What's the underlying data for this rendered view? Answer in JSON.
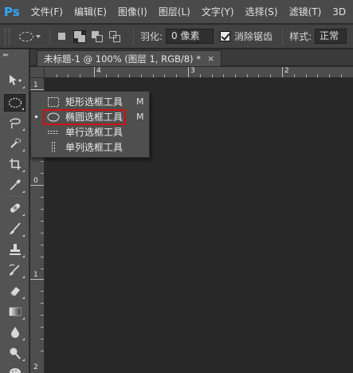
{
  "app": {
    "logo": "Ps"
  },
  "menubar": {
    "items": [
      "文件(F)",
      "编辑(E)",
      "图像(I)",
      "图层(L)",
      "文字(Y)",
      "选择(S)",
      "滤镜(T)",
      "3D"
    ]
  },
  "options": {
    "feather_label": "羽化:",
    "feather_value": "0 像素",
    "antialias_label": "消除锯齿",
    "antialias_checked": true,
    "style_label": "样式:",
    "style_value": "正常"
  },
  "document_tab": {
    "title": "未标题-1 @ 100% (图层 1, RGB/8) *",
    "close": "×"
  },
  "rulers": {
    "top_labels": [
      "4",
      "3",
      "2"
    ],
    "left_labels": [
      "1",
      "0",
      "1",
      "2"
    ]
  },
  "toolbox": {
    "collapse": "▸▸"
  },
  "flyout": {
    "items": [
      {
        "label": "矩形选框工具",
        "key": "M",
        "icon": "rect-marquee-icon",
        "selected": false
      },
      {
        "label": "椭圆选框工具",
        "key": "M",
        "icon": "ellipse-marquee-icon",
        "selected": true
      },
      {
        "label": "单行选框工具",
        "key": "",
        "icon": "single-row-marquee-icon",
        "selected": false
      },
      {
        "label": "单列选框工具",
        "key": "",
        "icon": "single-column-marquee-icon",
        "selected": false
      }
    ],
    "highlight_color": "#d01212"
  },
  "colors": {
    "ps_blue": "#31a8ff",
    "canvas": "#282828",
    "panel": "#535353"
  }
}
